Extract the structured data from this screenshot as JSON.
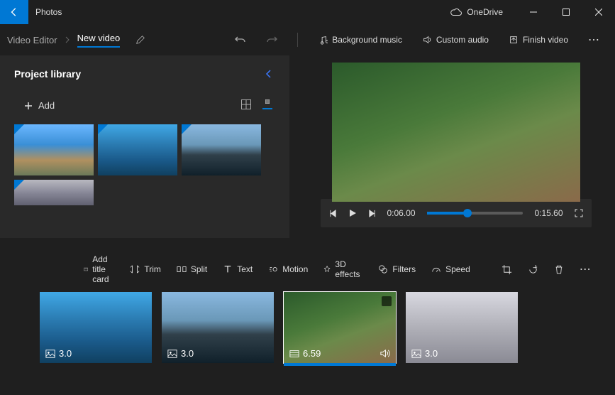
{
  "app": {
    "title": "Photos",
    "onedrive_label": "OneDrive"
  },
  "breadcrumb": {
    "root": "Video Editor",
    "current": "New video"
  },
  "toolbar": {
    "undo": "Undo",
    "redo": "Redo",
    "bg_music": "Background music",
    "custom_audio": "Custom audio",
    "finish": "Finish video"
  },
  "library": {
    "title": "Project library",
    "add_label": "Add"
  },
  "player": {
    "current": "0:06.00",
    "total": "0:15.60",
    "progress_pct": 38
  },
  "storyboard": {
    "tools": {
      "title_card": "Add title card",
      "trim": "Trim",
      "split": "Split",
      "text": "Text",
      "motion": "Motion",
      "effects3d": "3D effects",
      "filters": "Filters",
      "speed": "Speed"
    },
    "clips": [
      {
        "duration": "3.0",
        "type": "image",
        "selected": false
      },
      {
        "duration": "3.0",
        "type": "image",
        "selected": false
      },
      {
        "duration": "6.59",
        "type": "video",
        "selected": true,
        "audio": true
      },
      {
        "duration": "3.0",
        "type": "image",
        "selected": false
      }
    ]
  }
}
